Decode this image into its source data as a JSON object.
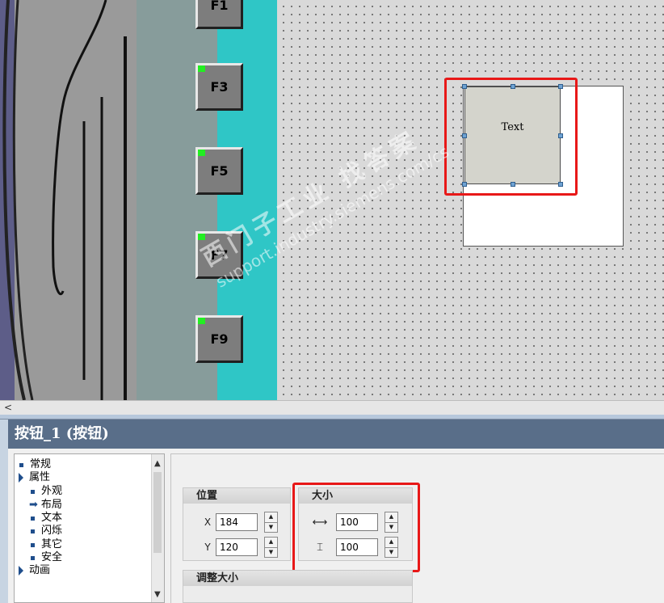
{
  "device": {
    "fkeys": [
      "F1",
      "F3",
      "F5",
      "F7",
      "F9"
    ]
  },
  "canvas": {
    "button_object_text": "Text"
  },
  "watermark": {
    "line1": "西门子工业   找答案",
    "line2": "support.industry.siemens.com/cs"
  },
  "hscroll": {
    "left_arrow": "<"
  },
  "props": {
    "title": "按钮_1 (按钮)",
    "tree": [
      {
        "label": "常规",
        "level": 0,
        "marker": "bullet"
      },
      {
        "label": "属性",
        "level": 0,
        "marker": "triangle"
      },
      {
        "label": "外观",
        "level": 1,
        "marker": "bullet"
      },
      {
        "label": "布局",
        "level": 1,
        "marker": "arrow",
        "selected": true
      },
      {
        "label": "文本",
        "level": 1,
        "marker": "bullet"
      },
      {
        "label": "闪烁",
        "level": 1,
        "marker": "bullet"
      },
      {
        "label": "其它",
        "level": 1,
        "marker": "bullet"
      },
      {
        "label": "安全",
        "level": 1,
        "marker": "bullet"
      },
      {
        "label": "动画",
        "level": 0,
        "marker": "triangle"
      }
    ],
    "position": {
      "title": "位置",
      "x_label": "X",
      "x_value": "184",
      "y_label": "Y",
      "y_value": "120"
    },
    "size": {
      "title": "大小",
      "width_icon": "width-arrows-icon",
      "width_value": "100",
      "height_icon": "height-arrows-icon",
      "height_value": "100"
    },
    "resize": {
      "title": "调整大小"
    }
  },
  "colors": {
    "highlight": "#e81818",
    "header": "#596e89",
    "teal": "#2fc6c6"
  }
}
